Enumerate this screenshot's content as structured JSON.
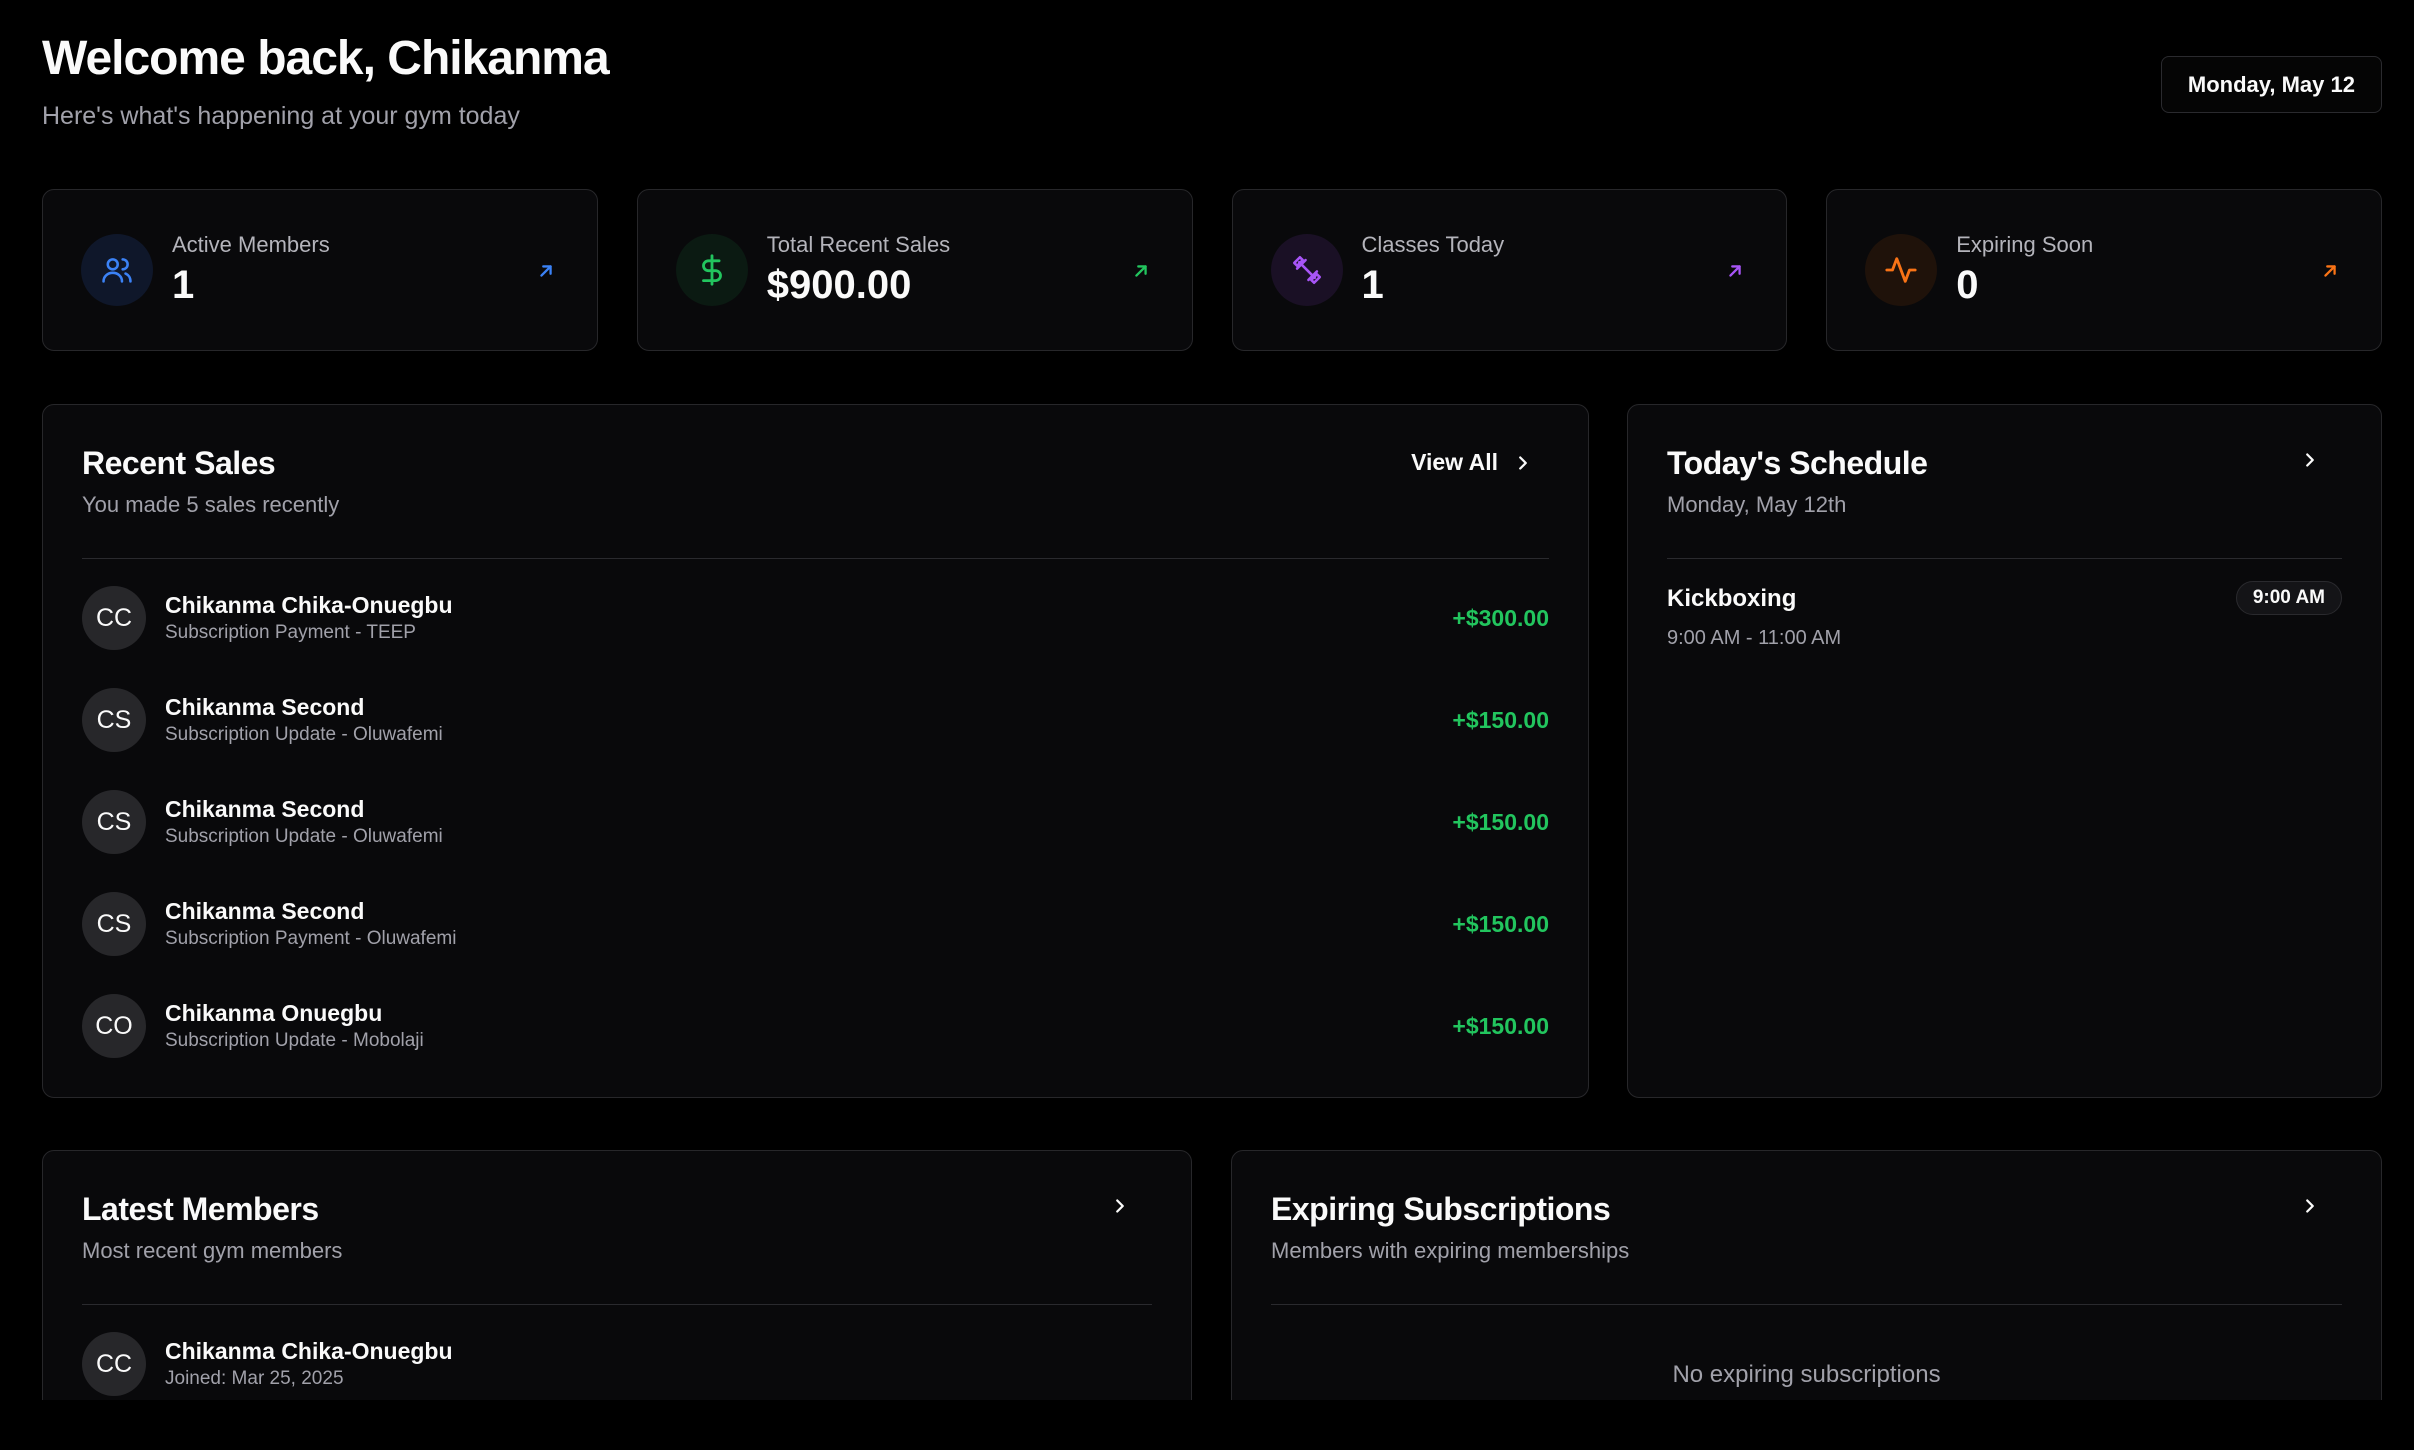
{
  "header": {
    "title": "Welcome back, Chikanma",
    "subtitle": "Here's what's happening at your gym today",
    "date": "Monday, May 12"
  },
  "stats": [
    {
      "label": "Active Members",
      "value": "1",
      "icon": "users-icon",
      "color": "#3b82f6",
      "bg": "#0f172a"
    },
    {
      "label": "Total Recent Sales",
      "value": "$900.00",
      "icon": "dollar-icon",
      "color": "#22c55e",
      "bg": "#0b1a12"
    },
    {
      "label": "Classes Today",
      "value": "1",
      "icon": "dumbbell-icon",
      "color": "#a855f7",
      "bg": "#1a1025"
    },
    {
      "label": "Expiring Soon",
      "value": "0",
      "icon": "activity-icon",
      "color": "#f97316",
      "bg": "#1f120a"
    }
  ],
  "recent_sales": {
    "title": "Recent Sales",
    "subtitle": "You made 5 sales recently",
    "view_all": "View All",
    "rows": [
      {
        "initials": "CC",
        "name": "Chikanma Chika-Onuegbu",
        "desc": "Subscription Payment - TEEP",
        "amount": "+$300.00"
      },
      {
        "initials": "CS",
        "name": "Chikanma Second",
        "desc": "Subscription Update - Oluwafemi",
        "amount": "+$150.00"
      },
      {
        "initials": "CS",
        "name": "Chikanma Second",
        "desc": "Subscription Update - Oluwafemi",
        "amount": "+$150.00"
      },
      {
        "initials": "CS",
        "name": "Chikanma Second",
        "desc": "Subscription Payment - Oluwafemi",
        "amount": "+$150.00"
      },
      {
        "initials": "CO",
        "name": "Chikanma Onuegbu",
        "desc": "Subscription Update - Mobolaji",
        "amount": "+$150.00"
      }
    ]
  },
  "schedule": {
    "title": "Today's Schedule",
    "subtitle": "Monday, May 12th",
    "items": [
      {
        "name": "Kickboxing",
        "time_range": "9:00 AM - 11:00 AM",
        "badge": "9:00 AM"
      }
    ]
  },
  "latest_members": {
    "title": "Latest Members",
    "subtitle": "Most recent gym members",
    "rows": [
      {
        "initials": "CC",
        "name": "Chikanma Chika-Onuegbu",
        "joined": "Joined: Mar 25, 2025"
      }
    ]
  },
  "expiring": {
    "title": "Expiring Subscriptions",
    "subtitle": "Members with expiring memberships",
    "empty": "No expiring subscriptions"
  }
}
